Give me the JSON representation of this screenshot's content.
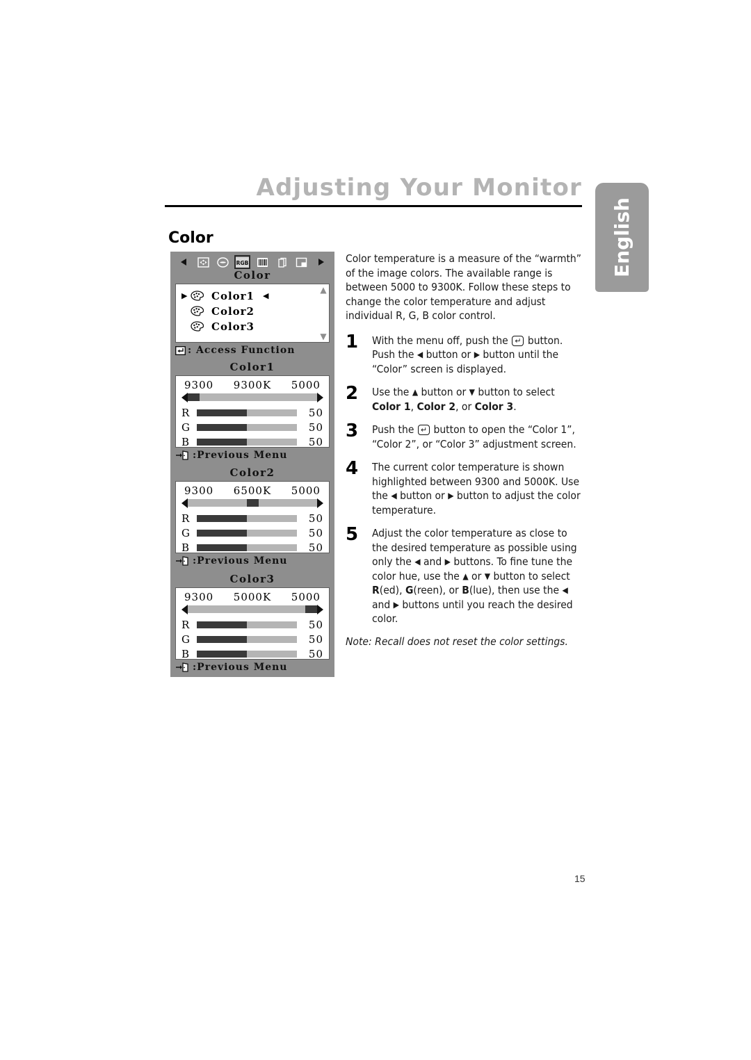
{
  "header": {
    "title": "Adjusting Your Monitor",
    "language_tab": "English"
  },
  "section": {
    "heading": "Color"
  },
  "osd_main": {
    "title": "Color",
    "icons": [
      {
        "name": "left-arrow-icon",
        "glyph": "◀"
      },
      {
        "name": "position-icon",
        "glyph": ""
      },
      {
        "name": "shape-icon",
        "glyph": ""
      },
      {
        "name": "rgb-icon",
        "glyph": "RGB",
        "selected": true
      },
      {
        "name": "moire-icon",
        "glyph": ""
      },
      {
        "name": "osd-pages-icon",
        "glyph": ""
      },
      {
        "name": "save-recall-icon",
        "glyph": ""
      },
      {
        "name": "right-arrow-icon",
        "glyph": "▶"
      }
    ],
    "items": [
      {
        "label": "Color1",
        "selected": true
      },
      {
        "label": "Color2",
        "selected": false
      },
      {
        "label": "Color3",
        "selected": false
      }
    ],
    "cursor": "▶",
    "right_cursor": "◀",
    "scroll_up": "▲",
    "scroll_down": "▼",
    "footer": ": Access Function"
  },
  "osd_panels": [
    {
      "title": "Color1",
      "temp_left": "9300",
      "temp_current": "9300K",
      "temp_right": "5000",
      "thumb_percent": 0,
      "rgb": [
        {
          "label": "R",
          "value": "50",
          "fill_percent": 50
        },
        {
          "label": "G",
          "value": "50",
          "fill_percent": 50
        },
        {
          "label": "B",
          "value": "50",
          "fill_percent": 50
        }
      ],
      "footer": ":Previous Menu"
    },
    {
      "title": "Color2",
      "temp_left": "9300",
      "temp_current": "6500K",
      "temp_right": "5000",
      "thumb_percent": 50,
      "rgb": [
        {
          "label": "R",
          "value": "50",
          "fill_percent": 50
        },
        {
          "label": "G",
          "value": "50",
          "fill_percent": 50
        },
        {
          "label": "B",
          "value": "50",
          "fill_percent": 50
        }
      ],
      "footer": ":Previous Menu"
    },
    {
      "title": "Color3",
      "temp_left": "9300",
      "temp_current": "5000K",
      "temp_right": "5000",
      "thumb_percent": 100,
      "rgb": [
        {
          "label": "R",
          "value": "50",
          "fill_percent": 50
        },
        {
          "label": "G",
          "value": "50",
          "fill_percent": 50
        },
        {
          "label": "B",
          "value": "50",
          "fill_percent": 50
        }
      ],
      "footer": ":Previous Menu"
    }
  ],
  "body": {
    "intro": "Color temperature is a measure of the “warmth” of the image colors. The available range is between 5000 to 9300K. Follow these steps to change the color temperature and adjust individual R, G, B color control.",
    "steps": [
      {
        "number": "1",
        "parts": [
          {
            "t": "text",
            "v": "With the menu off, push the "
          },
          {
            "t": "key",
            "v": "↵"
          },
          {
            "t": "text",
            "v": " button. Push the "
          },
          {
            "t": "arrow",
            "v": "◀"
          },
          {
            "t": "text",
            "v": " button or "
          },
          {
            "t": "arrow",
            "v": "▶"
          },
          {
            "t": "text",
            "v": " button until the “Color” screen is displayed."
          }
        ]
      },
      {
        "number": "2",
        "parts": [
          {
            "t": "text",
            "v": "Use the "
          },
          {
            "t": "arrow",
            "v": "▲"
          },
          {
            "t": "text",
            "v": " button or "
          },
          {
            "t": "arrow",
            "v": "▼"
          },
          {
            "t": "text",
            "v": " button to select "
          },
          {
            "t": "bold",
            "v": "Color 1"
          },
          {
            "t": "text",
            "v": ", "
          },
          {
            "t": "bold",
            "v": "Color 2"
          },
          {
            "t": "text",
            "v": ", or "
          },
          {
            "t": "bold",
            "v": "Color 3"
          },
          {
            "t": "text",
            "v": "."
          }
        ]
      },
      {
        "number": "3",
        "parts": [
          {
            "t": "text",
            "v": "Push the "
          },
          {
            "t": "key",
            "v": "↵"
          },
          {
            "t": "text",
            "v": " button to open the “Color 1”, “Color 2”, or “Color 3” adjustment screen."
          }
        ]
      },
      {
        "number": "4",
        "parts": [
          {
            "t": "text",
            "v": "The current color temperature is shown highlighted between 9300 and 5000K. Use the "
          },
          {
            "t": "arrow",
            "v": "◀"
          },
          {
            "t": "text",
            "v": " button or "
          },
          {
            "t": "arrow",
            "v": "▶"
          },
          {
            "t": "text",
            "v": " button to adjust the color temperature."
          }
        ]
      },
      {
        "number": "5",
        "parts": [
          {
            "t": "text",
            "v": "Adjust the color temperature as close to the desired temperature as possible using only the "
          },
          {
            "t": "arrow",
            "v": "◀"
          },
          {
            "t": "text",
            "v": " and "
          },
          {
            "t": "arrow",
            "v": "▶"
          },
          {
            "t": "text",
            "v": " buttons. To fine tune the color hue, use the "
          },
          {
            "t": "arrow",
            "v": "▲"
          },
          {
            "t": "text",
            "v": " or "
          },
          {
            "t": "arrow",
            "v": "▼"
          },
          {
            "t": "text",
            "v": " button to select "
          },
          {
            "t": "bold",
            "v": "R"
          },
          {
            "t": "text",
            "v": "(ed), "
          },
          {
            "t": "bold",
            "v": "G"
          },
          {
            "t": "text",
            "v": "(reen), or "
          },
          {
            "t": "bold",
            "v": "B"
          },
          {
            "t": "text",
            "v": "(lue), then use the "
          },
          {
            "t": "arrow",
            "v": "◀"
          },
          {
            "t": "text",
            "v": " and "
          },
          {
            "t": "arrow",
            "v": "▶"
          },
          {
            "t": "text",
            "v": " buttons until you reach the desired color."
          }
        ]
      }
    ],
    "note": "Note: Recall does not reset the color settings."
  },
  "footer": {
    "page_number": "15"
  }
}
